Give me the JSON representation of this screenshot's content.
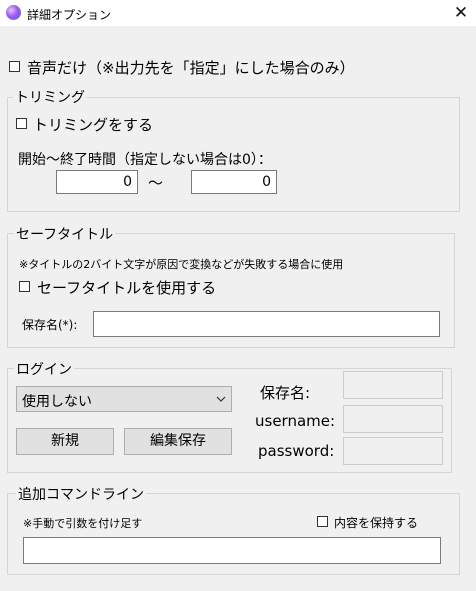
{
  "window": {
    "title": "詳細オプション",
    "close_glyph": "✕"
  },
  "audio_only": {
    "label": "音声だけ（※出力先を「指定」にした場合のみ）",
    "checked": false
  },
  "trimming": {
    "group_label": "トリミング",
    "enable_label": "トリミングをする",
    "time_label": "開始～終了時間（指定しない場合は0）：",
    "start_value": "0",
    "separator": "～",
    "end_value": "0"
  },
  "safe_title": {
    "group_label": "セーフタイトル",
    "note": "※タイトルの2バイト文字が原因で変換などが失敗する場合に使用",
    "use_label": "セーフタイトルを使用する",
    "save_name_label": "保存名(*):",
    "save_name_value": ""
  },
  "login": {
    "group_label": "ログイン",
    "select_value": "使用しない",
    "new_button": "新規",
    "edit_save_button": "編集保存",
    "save_name_label": "保存名:",
    "username_label": "username:",
    "password_label": "password:"
  },
  "extra_cmd": {
    "group_label": "追加コマンドライン",
    "note": "※手動で引数を付け足す",
    "keep_label": "内容を保持する",
    "value": ""
  },
  "colors": {
    "window_bg": "#f0f0f0",
    "titlebar_bg": "#ffffff",
    "button_bg": "#e1e1e1"
  }
}
